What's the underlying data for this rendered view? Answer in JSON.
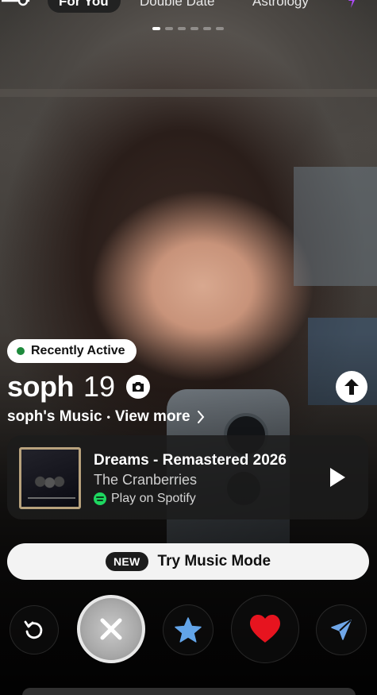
{
  "top_nav": {
    "tabs": [
      {
        "label": "For You",
        "selected": true
      },
      {
        "label": "Double Date",
        "selected": false
      },
      {
        "label": "Astrology",
        "selected": false
      }
    ]
  },
  "photo_carousel": {
    "photo_count": 6,
    "current_index": 1
  },
  "profile": {
    "activity_badge": "Recently Active",
    "name": "soph",
    "age": "19"
  },
  "music": {
    "section_title": "soph's Music",
    "separator": "•",
    "view_more_label": "View more",
    "song_title": "Dreams - Remastered 2026",
    "artist": "The Cranberries",
    "spotify_label": "Play on Spotify"
  },
  "music_mode": {
    "badge": "NEW",
    "label": "Try Music Mode"
  },
  "actions": [
    {
      "name": "rewind",
      "icon": "rewind-icon"
    },
    {
      "name": "nope",
      "icon": "close-icon"
    },
    {
      "name": "super-like",
      "icon": "star-icon"
    },
    {
      "name": "like",
      "icon": "heart-icon"
    },
    {
      "name": "boost",
      "icon": "send-icon"
    }
  ],
  "colors": {
    "active_green": "#1e8a3c",
    "spotify_green": "#1ed760",
    "like_red": "#e7141f",
    "star_blue": "#62a4e8",
    "boost_blue": "#6fa6e8",
    "nav_accent": "#b14cff"
  }
}
